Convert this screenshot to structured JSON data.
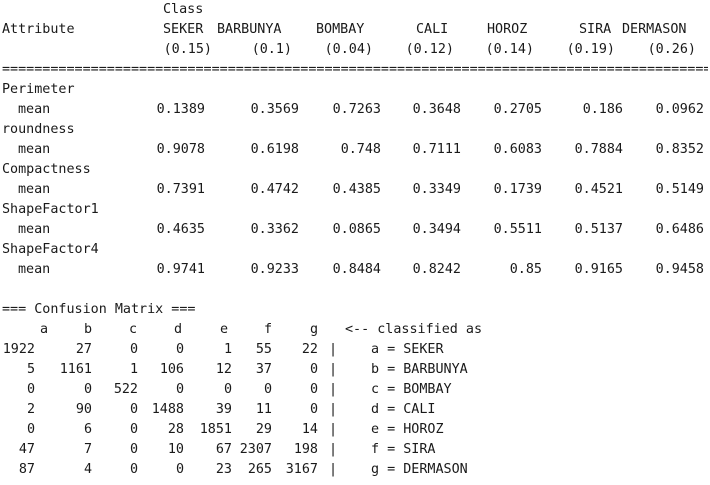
{
  "header": {
    "class_label": "Class",
    "attribute_label": "Attribute",
    "classes": [
      {
        "name": "SEKER",
        "prior": "(0.15)"
      },
      {
        "name": "BARBUNYA",
        "prior": "(0.1)"
      },
      {
        "name": "BOMBAY",
        "prior": "(0.04)"
      },
      {
        "name": "CALI",
        "prior": "(0.12)"
      },
      {
        "name": "HOROZ",
        "prior": "(0.14)"
      },
      {
        "name": "SIRA",
        "prior": "(0.19)"
      },
      {
        "name": "DERMASON",
        "prior": "(0.26)"
      }
    ],
    "separator": "==========================================================================================="
  },
  "attributes": [
    {
      "name": "Perimeter",
      "stat": "mean",
      "values": [
        "0.1389",
        "0.3569",
        "0.7263",
        "0.3648",
        "0.2705",
        "0.186",
        "0.0962"
      ]
    },
    {
      "name": "roundness",
      "stat": "mean",
      "values": [
        "0.9078",
        "0.6198",
        "0.748",
        "0.7111",
        "0.6083",
        "0.7884",
        "0.8352"
      ]
    },
    {
      "name": "Compactness",
      "stat": "mean",
      "values": [
        "0.7391",
        "0.4742",
        "0.4385",
        "0.3349",
        "0.1739",
        "0.4521",
        "0.5149"
      ]
    },
    {
      "name": "ShapeFactor1",
      "stat": "mean",
      "values": [
        "0.4635",
        "0.3362",
        "0.0865",
        "0.3494",
        "0.5511",
        "0.5137",
        "0.6486"
      ]
    },
    {
      "name": "ShapeFactor4",
      "stat": "mean",
      "values": [
        "0.9741",
        "0.9233",
        "0.8484",
        "0.8242",
        "0.85",
        "0.9165",
        "0.9458"
      ]
    }
  ],
  "confusion": {
    "title": "=== Confusion Matrix ===",
    "column_letters": [
      "a",
      "b",
      "c",
      "d",
      "e",
      "f",
      "g"
    ],
    "classified_as_label": "<-- classified as",
    "pipe": "|",
    "rows": [
      {
        "cells": [
          "1922",
          "27",
          "0",
          "0",
          "1",
          "55",
          "22"
        ],
        "label": "a = SEKER"
      },
      {
        "cells": [
          "5",
          "1161",
          "1",
          "106",
          "12",
          "37",
          "0"
        ],
        "label": "b = BARBUNYA"
      },
      {
        "cells": [
          "0",
          "0",
          "522",
          "0",
          "0",
          "0",
          "0"
        ],
        "label": "c = BOMBAY"
      },
      {
        "cells": [
          "2",
          "90",
          "0",
          "1488",
          "39",
          "11",
          "0"
        ],
        "label": "d = CALI"
      },
      {
        "cells": [
          "0",
          "6",
          "0",
          "28",
          "1851",
          "29",
          "14"
        ],
        "label": "e = HOROZ"
      },
      {
        "cells": [
          "47",
          "7",
          "0",
          "10",
          "67",
          "2307",
          "198"
        ],
        "label": "f = SIRA"
      },
      {
        "cells": [
          "87",
          "4",
          "0",
          "0",
          "23",
          "265",
          "3167"
        ],
        "label": "g = DERMASON"
      }
    ]
  }
}
